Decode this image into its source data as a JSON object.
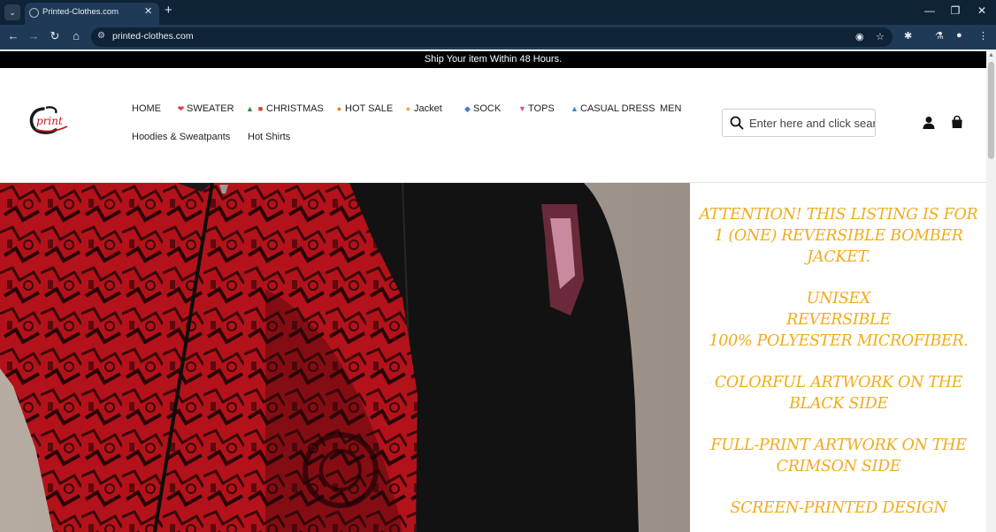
{
  "browser": {
    "tab_title": "Printed-Clothes.com",
    "url": "printed-clothes.com",
    "new_tab": "+",
    "tab_close": "✕",
    "tab_menu": "⌄",
    "window": {
      "minimize": "—",
      "restore": "❐",
      "close": "✕"
    }
  },
  "announcement": "Ship Your item Within 48 Hours.",
  "logo_text": "print",
  "nav": {
    "home": "HOME",
    "sweater": "SWEATER",
    "christmas": "CHRISTMAS",
    "hot_sale": "HOT SALE",
    "jacket": "Jacket",
    "sock": "SOCK",
    "tops": "TOPS",
    "casual_dress": "CASUAL DRESS",
    "men": "MEN",
    "hoodies": "Hoodies & Sweatpants",
    "hot_shirts": "Hot Shirts",
    "emoji": {
      "sweater": "❤",
      "christmas_tree": "▲",
      "christmas_gift": "■",
      "hot_sale": "●",
      "jacket": "●",
      "sock": "◆",
      "tops": "▼",
      "casual_dress": "▲"
    }
  },
  "search": {
    "placeholder": "Enter here and click search"
  },
  "description": [
    "ATTENTION! THIS LISTING IS FOR",
    "1 (ONE) REVERSIBLE BOMBER",
    "JACKET.",
    "UNISEX",
    "REVERSIBLE",
    "100% POLYESTER MICROFIBER.",
    "COLORFUL ARTWORK ON THE",
    "BLACK SIDE",
    "FULL-PRINT ARTWORK ON THE",
    "CRIMSON SIDE",
    "SCREEN-PRINTED DESIGN"
  ],
  "colors": {
    "chrome_dark": "#0f2336",
    "chrome": "#1f3a56",
    "accent_text": "#f0ac1b",
    "jacket_red": "#c0161c",
    "jacket_black": "#111111"
  }
}
